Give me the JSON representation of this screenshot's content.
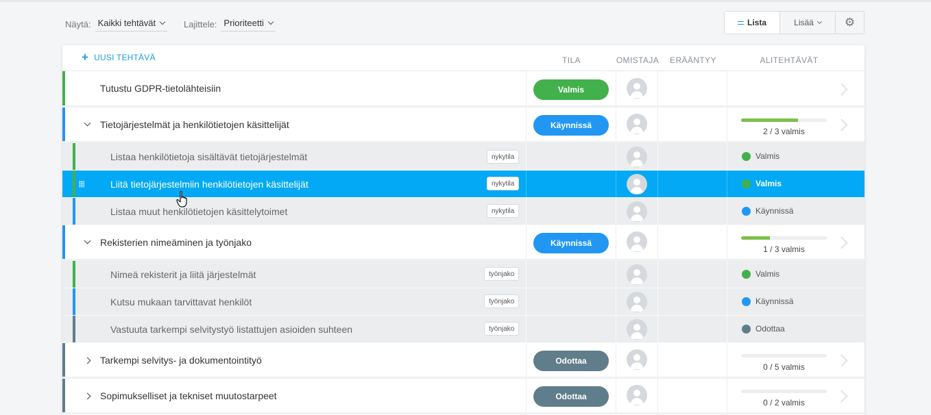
{
  "toolbar": {
    "show_label": "Näytä:",
    "show_value": "Kaikki tehtävät",
    "sort_label": "Lajittele:",
    "sort_value": "Prioriteetti",
    "view_list": "Lista",
    "view_more": "Lisää"
  },
  "table": {
    "new_task": "UUSI TEHTÄVÄ",
    "col_status": "TILA",
    "col_owner": "OMISTAJA",
    "col_due": "ERÄÄNTYY",
    "col_subtasks": "ALITEHTÄVÄT"
  },
  "colors": {
    "done": "#43b14b",
    "in_progress": "#2196f3",
    "waiting": "#607d8b",
    "accent": "#03a9f4"
  },
  "rows": [
    {
      "title": "Tutustu GDPR-tietolähteisiin",
      "status": "Valmis",
      "status_key": "done",
      "expand": "none"
    },
    {
      "title": "Tietojärjestelmät ja henkilötietojen käsittelijät",
      "status": "Käynnissä",
      "status_key": "in_progress",
      "expand": "expanded",
      "progress_fraction": 0.667,
      "progress_text": "2 / 3 valmis",
      "children": [
        {
          "title": "Listaa henkilötietoja sisältävät tietojärjestelmät",
          "tag": "nykytila",
          "status": "Valmis",
          "status_key": "done"
        },
        {
          "title": "Liitä tietojärjestelmiin henkilötietojen käsittelijät",
          "tag": "nykytila",
          "status": "Valmis",
          "status_key": "done",
          "selected": true
        },
        {
          "title": "Listaa muut henkilötietojen käsittelytoimet",
          "tag": "nykytila",
          "status": "Käynnissä",
          "status_key": "in_progress"
        }
      ]
    },
    {
      "title": "Rekisterien nimeäminen ja työnjako",
      "status": "Käynnissä",
      "status_key": "in_progress",
      "expand": "expanded",
      "progress_fraction": 0.333,
      "progress_text": "1 / 3 valmis",
      "children": [
        {
          "title": "Nimeä rekisterit ja liitä järjestelmät",
          "tag": "työnjako",
          "status": "Valmis",
          "status_key": "done"
        },
        {
          "title": "Kutsu mukaan tarvittavat henkilöt",
          "tag": "työnjako",
          "status": "Käynnissä",
          "status_key": "in_progress"
        },
        {
          "title": "Vastuuta tarkempi selvitystyö listattujen asioiden suhteen",
          "tag": "työnjako",
          "status": "Odottaa",
          "status_key": "waiting"
        }
      ]
    },
    {
      "title": "Tarkempi selvitys- ja dokumentointityö",
      "status": "Odottaa",
      "status_key": "waiting",
      "expand": "collapsed",
      "progress_fraction": 0,
      "progress_text": "0 / 5 valmis"
    },
    {
      "title": "Sopimukselliset ja tekniset muutostarpeet",
      "status": "Odottaa",
      "status_key": "waiting",
      "expand": "collapsed",
      "progress_fraction": 0,
      "progress_text": "0 / 2 valmis"
    }
  ]
}
